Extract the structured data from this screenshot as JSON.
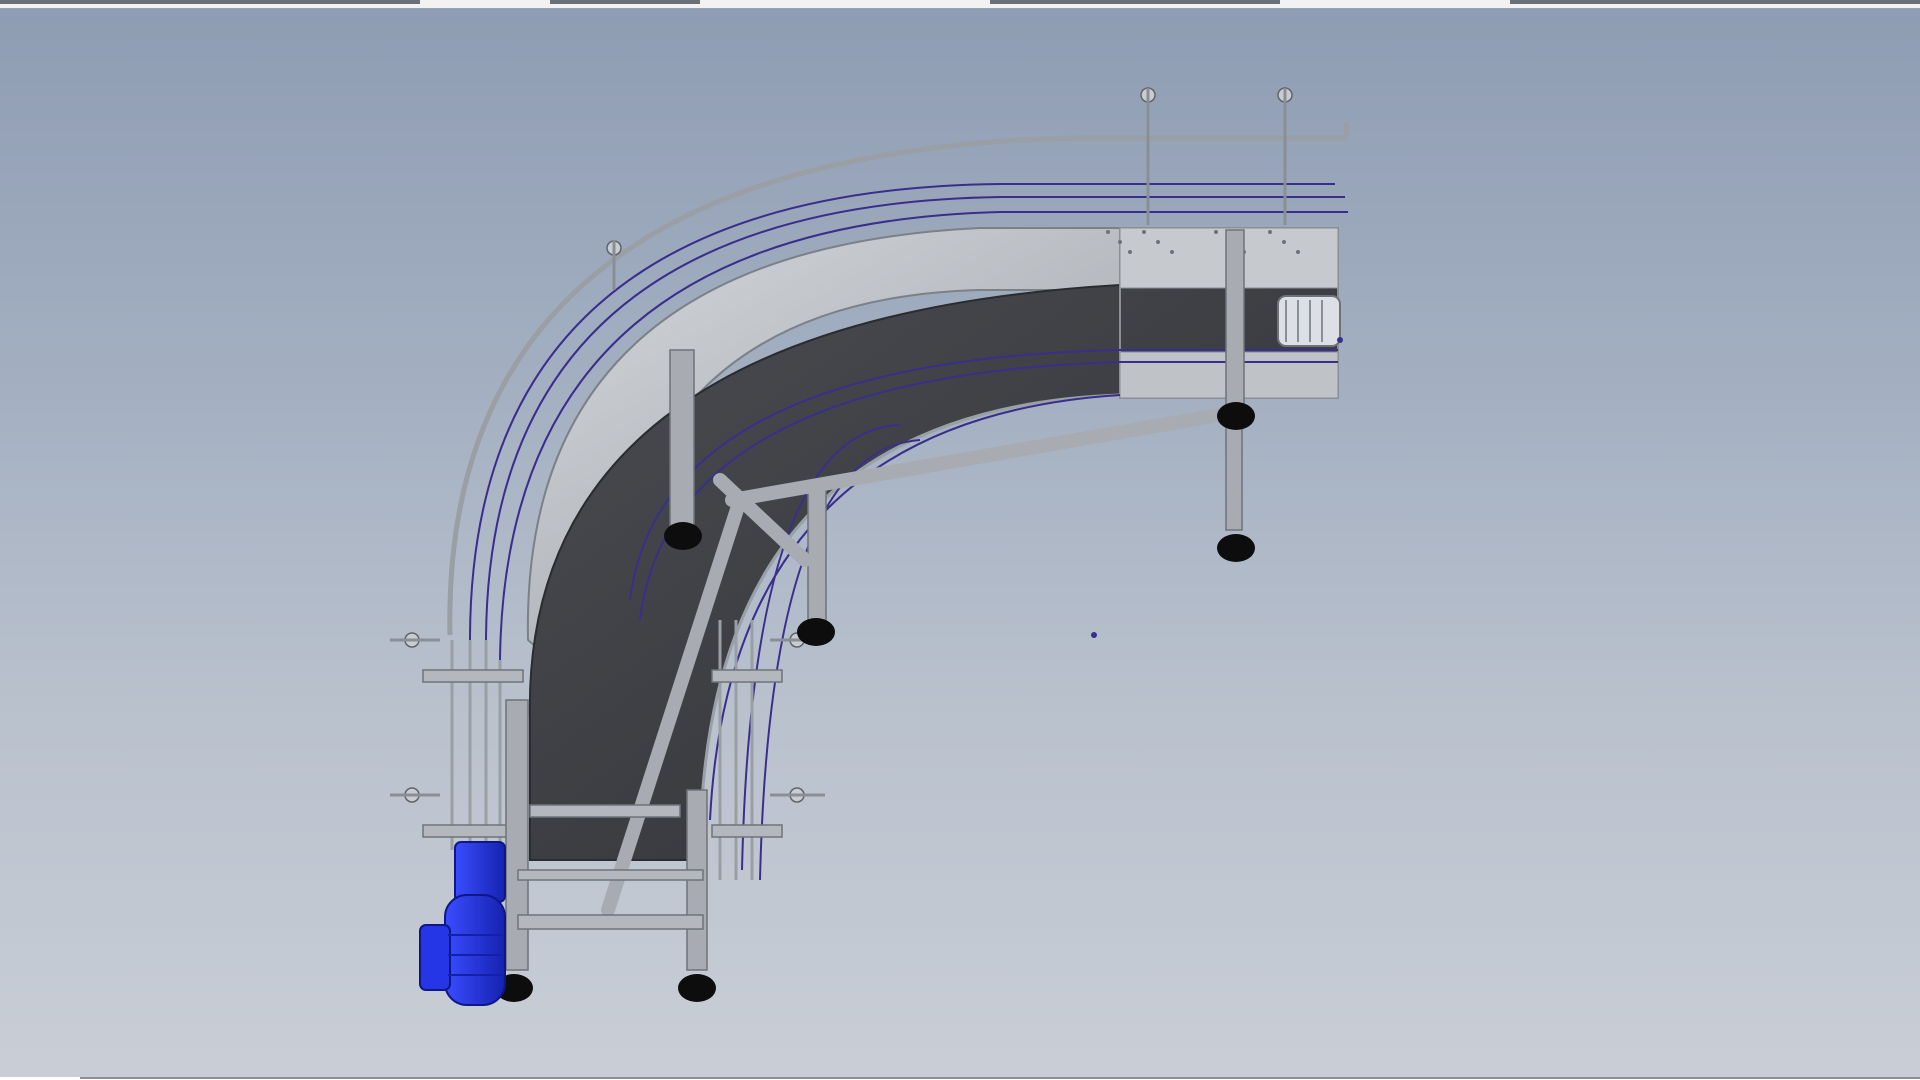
{
  "window": {
    "view": "3d-model-viewport"
  },
  "model": {
    "icons": {
      "model": "conveyor-model-icon",
      "motor": "drive-motor-icon",
      "drum": "drive-drum-icon"
    },
    "colors": {
      "background_top": "#8e9cb3",
      "background_bottom": "#c9ced6",
      "frame": "#a9adb3",
      "belt": "#3f4145",
      "guide_rail": "#3a2e8c",
      "motor": "#1f2fd1",
      "foot": "#0d0d0d"
    }
  }
}
